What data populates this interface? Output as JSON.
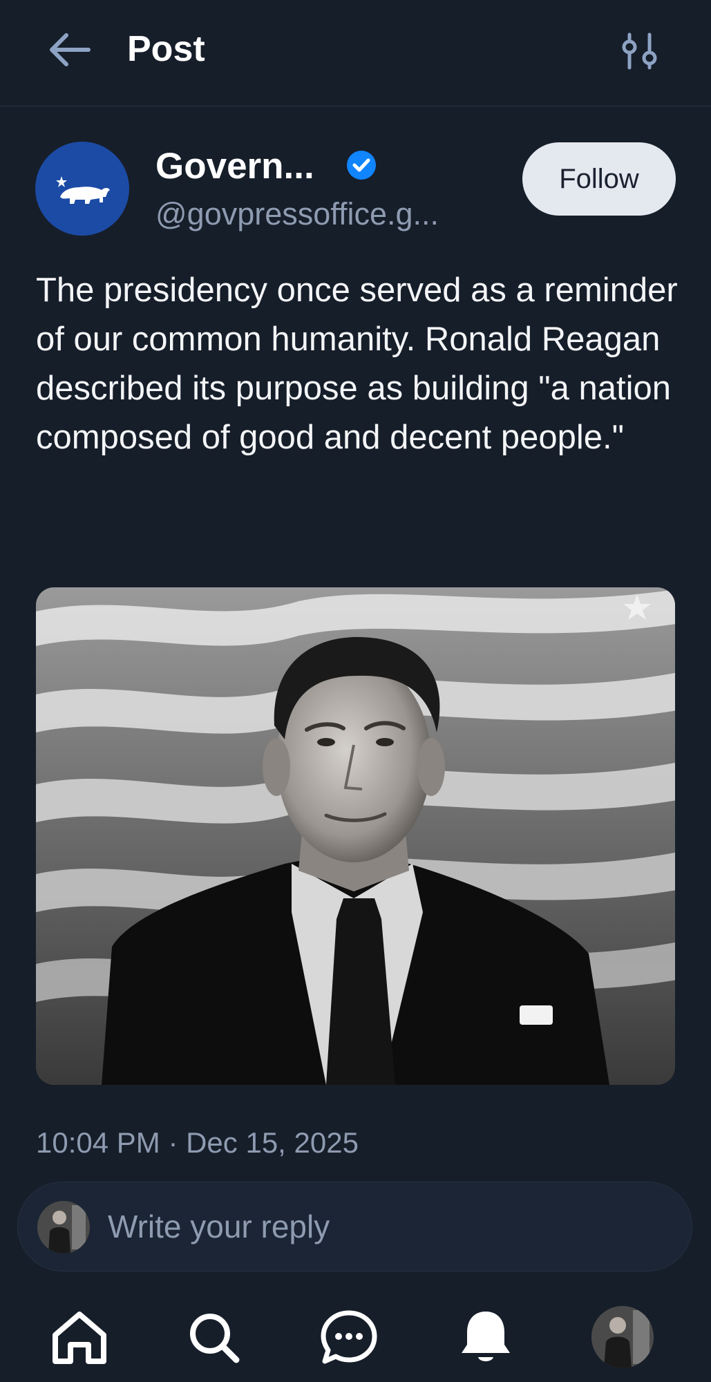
{
  "header": {
    "title": "Post",
    "back_icon": "arrow-left-icon",
    "settings_icon": "sliders-icon"
  },
  "author": {
    "display_name": "Govern...",
    "handle": "@govpressoffice.g...",
    "verified": true,
    "avatar": "california-bear-logo",
    "avatar_color": "#1c4ba6",
    "follow_label": "Follow"
  },
  "post": {
    "text": "The presidency once served as a reminder of our common humanity. Ronald Reagan described its purpose as building \"a nation composed of good and decent people.\"",
    "image": "black-and-white-portrait-with-american-flag",
    "timestamp": "10:04 PM · Dec 15, 2025"
  },
  "reply": {
    "placeholder": "Write your reply"
  },
  "nav": {
    "items": [
      "home-icon",
      "search-icon",
      "chat-icon",
      "bell-icon",
      "profile-avatar"
    ]
  },
  "colors": {
    "background": "#161e2a",
    "accent": "#1185fe",
    "muted_text": "#8e9bb0",
    "follow_button_bg": "#e4e8ef"
  }
}
